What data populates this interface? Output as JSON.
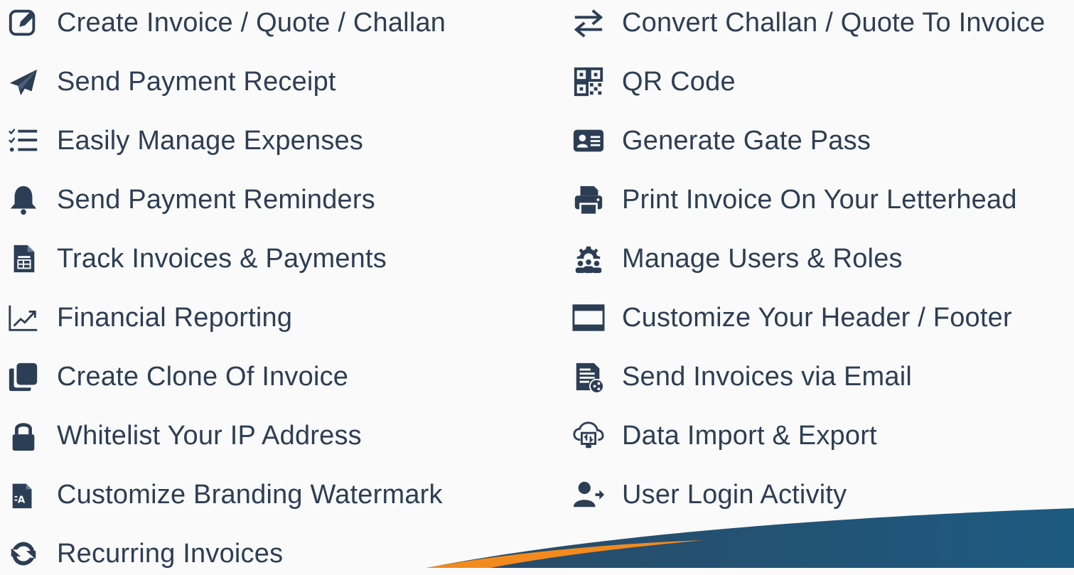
{
  "features_left": [
    {
      "label": "Create Invoice / Quote / Challan",
      "icon": "edit-icon"
    },
    {
      "label": "Send Payment Receipt",
      "icon": "paper-plane-icon"
    },
    {
      "label": "Easily Manage Expenses",
      "icon": "checklist-icon"
    },
    {
      "label": "Send Payment Reminders",
      "icon": "bell-icon"
    },
    {
      "label": "Track Invoices & Payments",
      "icon": "document-table-icon"
    },
    {
      "label": "Financial Reporting",
      "icon": "chart-trend-icon"
    },
    {
      "label": "Create Clone Of Invoice",
      "icon": "copy-icon"
    },
    {
      "label": "Whitelist Your IP Address",
      "icon": "lock-icon"
    },
    {
      "label": "Customize Branding Watermark",
      "icon": "watermark-file-icon"
    },
    {
      "label": "Recurring Invoices",
      "icon": "sync-icon"
    }
  ],
  "features_right": [
    {
      "label": "Convert Challan / Quote To Invoice",
      "icon": "swap-arrows-icon"
    },
    {
      "label": "QR Code",
      "icon": "qr-code-icon"
    },
    {
      "label": "Generate Gate Pass",
      "icon": "id-card-icon"
    },
    {
      "label": "Print Invoice On Your Letterhead",
      "icon": "printer-icon"
    },
    {
      "label": "Manage Users & Roles",
      "icon": "users-gear-icon"
    },
    {
      "label": "Customize Your Header / Footer",
      "icon": "layout-window-icon"
    },
    {
      "label": "Send Invoices via Email",
      "icon": "invoice-share-icon"
    },
    {
      "label": "Data Import & Export",
      "icon": "cloud-sync-icon"
    },
    {
      "label": "User Login Activity",
      "icon": "user-login-icon"
    }
  ],
  "colors": {
    "icon": "#2c3e55",
    "text": "#2d3e54",
    "swoosh_blue": "#1f4f74",
    "swoosh_orange": "#f28a1e"
  }
}
